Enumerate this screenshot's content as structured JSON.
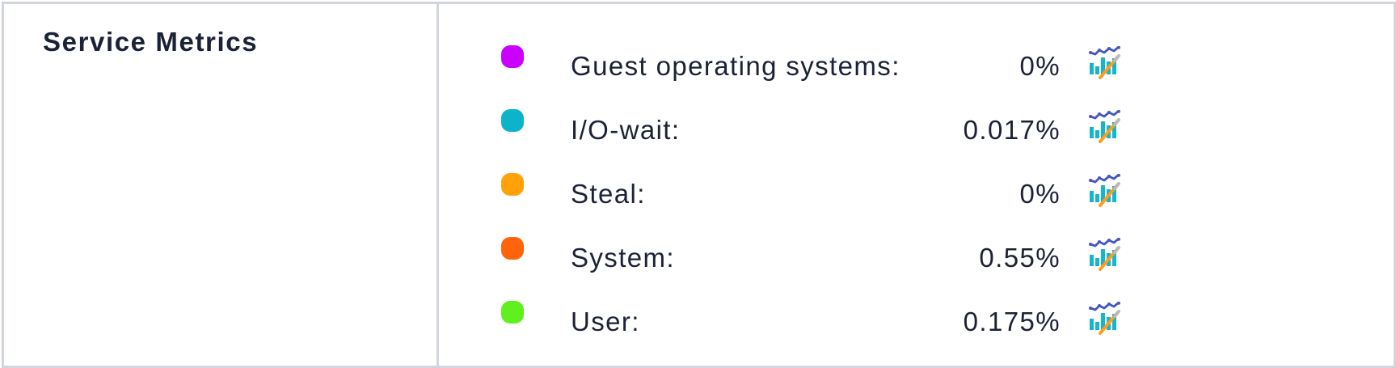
{
  "section": {
    "title": "Service Metrics"
  },
  "metrics": [
    {
      "label": "Guest operating systems:",
      "value": "0%",
      "color": "#cc00ff",
      "icon": "chart-icon"
    },
    {
      "label": "I/O-wait:",
      "value": "0.017%",
      "color": "#0db4c9",
      "icon": "chart-icon"
    },
    {
      "label": "Steal:",
      "value": "0%",
      "color": "#ffa20a",
      "icon": "chart-icon"
    },
    {
      "label": "System:",
      "value": "0.55%",
      "color": "#ff640a",
      "icon": "chart-icon"
    },
    {
      "label": "User:",
      "value": "0.175%",
      "color": "#5ff01e",
      "icon": "chart-icon"
    }
  ],
  "colors": {
    "text": "#1b2236",
    "border": "#d3d5de",
    "icon_line": "#4656c2",
    "icon_bars": "#14b6cf",
    "icon_pencil": "#ff9d1a"
  }
}
